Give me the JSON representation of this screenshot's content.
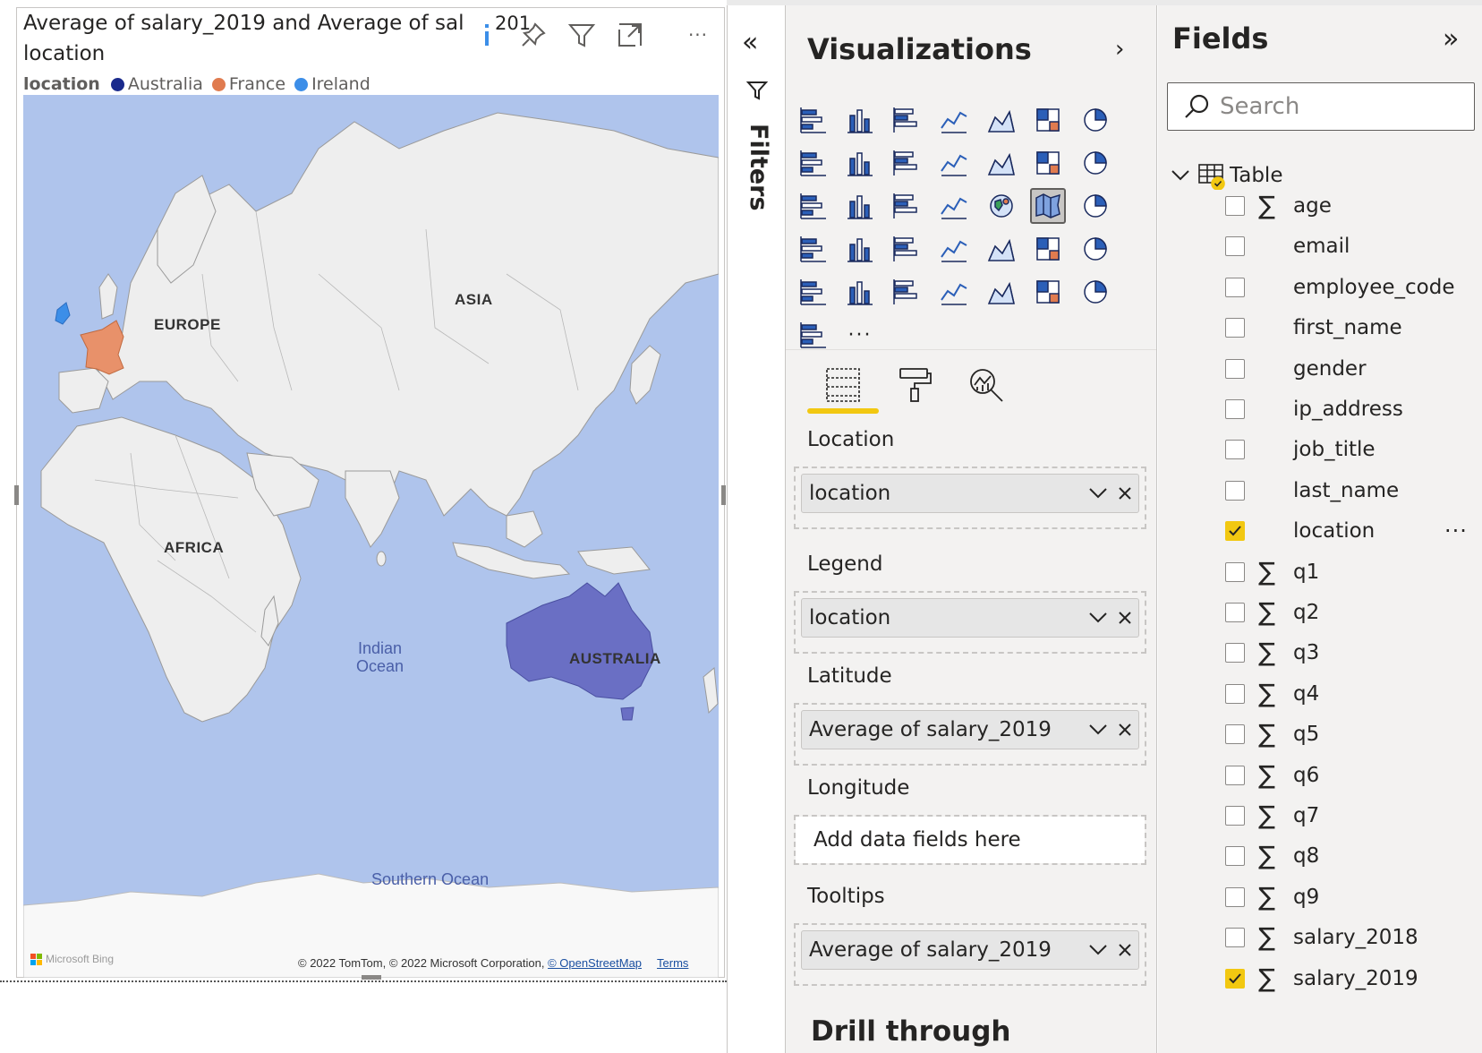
{
  "visual": {
    "title_line1": "Average of salary_2019 and Average of sal",
    "title_line2": "location",
    "title_fragment": "201",
    "legend_title": "location",
    "legend_items": [
      {
        "label": "Australia",
        "color": "#1a2a8c"
      },
      {
        "label": "France",
        "color": "#e07b4f"
      },
      {
        "label": "Ireland",
        "color": "#3c8ee8"
      }
    ],
    "header_icons": [
      "info-icon",
      "pin-icon",
      "filter-icon",
      "focus-mode-icon",
      "more-options-icon"
    ],
    "map": {
      "labels": {
        "europe": "EUROPE",
        "asia": "ASIA",
        "africa": "AFRICA",
        "australia": "AUSTRALIA"
      },
      "oceans": {
        "indian_line1": "Indian",
        "indian_line2": "Ocean",
        "southern": "Southern Ocean"
      },
      "colors": {
        "water": "#afc4ec",
        "land": "#eeeeee",
        "france": "#e8916a",
        "australia": "#6a6fc4",
        "ireland": "#3c8ee8"
      },
      "attribution": "© 2022 TomTom, © 2022 Microsoft Corporation,",
      "osm_link": "© OpenStreetMap",
      "terms_link": "Terms",
      "bing_logo": "Microsoft Bing"
    }
  },
  "filters": {
    "label": "Filters",
    "collapse_icon": "double-chevron-left-icon"
  },
  "visualizations": {
    "title": "Visualizations",
    "selected_visual": "filled-map",
    "more_label": "···",
    "tabs": [
      "build-visual",
      "format-visual",
      "analytics"
    ],
    "wells": [
      {
        "label": "Location",
        "value": "location"
      },
      {
        "label": "Legend",
        "value": "location"
      },
      {
        "label": "Latitude",
        "value": "Average of salary_2019"
      },
      {
        "label": "Longitude",
        "placeholder": "Add data fields here"
      },
      {
        "label": "Tooltips",
        "value": "Average of salary_2019"
      }
    ],
    "drill_through": "Drill through",
    "accent": "#f2c811"
  },
  "fields": {
    "title": "Fields",
    "search_placeholder": "Search",
    "table_name": "Table",
    "more_label": "···",
    "items": [
      {
        "name": "age",
        "sigma": true,
        "checked": false
      },
      {
        "name": "email",
        "sigma": false,
        "checked": false
      },
      {
        "name": "employee_code",
        "sigma": false,
        "checked": false
      },
      {
        "name": "first_name",
        "sigma": false,
        "checked": false
      },
      {
        "name": "gender",
        "sigma": false,
        "checked": false
      },
      {
        "name": "ip_address",
        "sigma": false,
        "checked": false
      },
      {
        "name": "job_title",
        "sigma": false,
        "checked": false
      },
      {
        "name": "last_name",
        "sigma": false,
        "checked": false
      },
      {
        "name": "location",
        "sigma": false,
        "checked": true
      },
      {
        "name": "q1",
        "sigma": true,
        "checked": false
      },
      {
        "name": "q2",
        "sigma": true,
        "checked": false
      },
      {
        "name": "q3",
        "sigma": true,
        "checked": false
      },
      {
        "name": "q4",
        "sigma": true,
        "checked": false
      },
      {
        "name": "q5",
        "sigma": true,
        "checked": false
      },
      {
        "name": "q6",
        "sigma": true,
        "checked": false
      },
      {
        "name": "q7",
        "sigma": true,
        "checked": false
      },
      {
        "name": "q8",
        "sigma": true,
        "checked": false
      },
      {
        "name": "q9",
        "sigma": true,
        "checked": false
      },
      {
        "name": "salary_2018",
        "sigma": true,
        "checked": false
      },
      {
        "name": "salary_2019",
        "sigma": true,
        "checked": true
      }
    ]
  }
}
